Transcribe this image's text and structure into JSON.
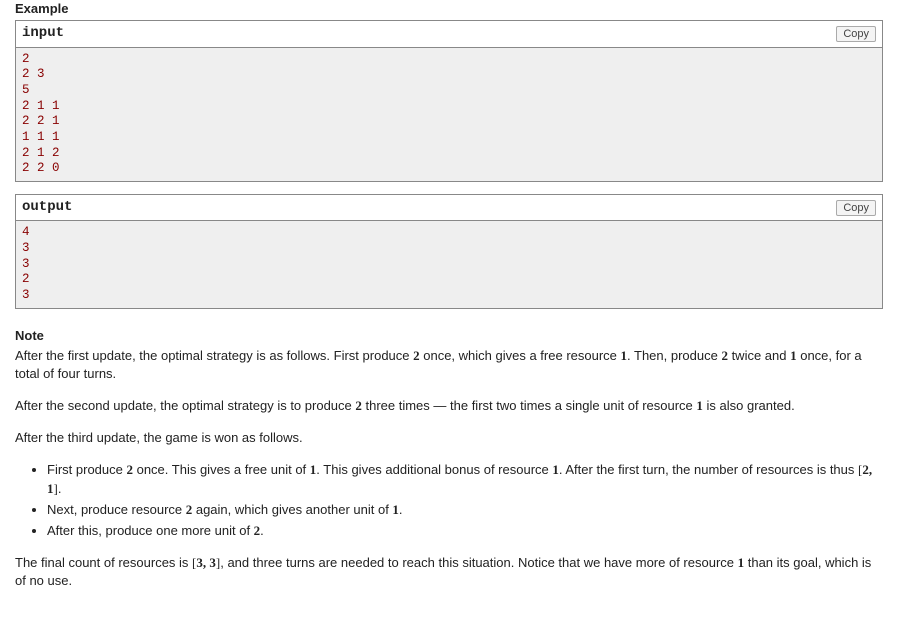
{
  "example_heading": "Example",
  "input": {
    "label": "input",
    "copy": "Copy",
    "content": "2\n2 3\n5\n2 1 1\n2 2 1\n1 1 1\n2 1 2\n2 2 0"
  },
  "output": {
    "label": "output",
    "copy": "Copy",
    "content": "4\n3\n3\n2\n3"
  },
  "note": {
    "heading": "Note",
    "p1a": "After the first update, the optimal strategy is as follows. First produce ",
    "p1b": " once, which gives a free resource ",
    "p1c": ". Then, produce ",
    "p1d": " twice and ",
    "p1e": " once, for a total of four turns.",
    "p2a": "After the second update, the optimal strategy is to produce ",
    "p2b": " three times — the first two times a single unit of resource ",
    "p2c": " is also granted.",
    "p3": "After the third update, the game is won as follows.",
    "li1a": "First produce ",
    "li1b": " once. This gives a free unit of ",
    "li1c": ". This gives additional bonus of resource ",
    "li1d": ". After the first turn, the number of resources is thus ",
    "li1e": ".",
    "li2a": "Next, produce resource ",
    "li2b": " again, which gives another unit of ",
    "li2c": ".",
    "li3a": "After this, produce one more unit of ",
    "li3b": ".",
    "p4a": "The final count of resources is ",
    "p4b": ", and three turns are needed to reach this situation. Notice that we have more of resource ",
    "p4c": " than its goal, which is of no use.",
    "m_two": "2",
    "m_one": "1",
    "m_pair21_l": "[",
    "m_pair21_v": "2, 1",
    "m_pair21_r": "]",
    "m_pair33_l": "[",
    "m_pair33_v": "3, 3",
    "m_pair33_r": "]"
  }
}
